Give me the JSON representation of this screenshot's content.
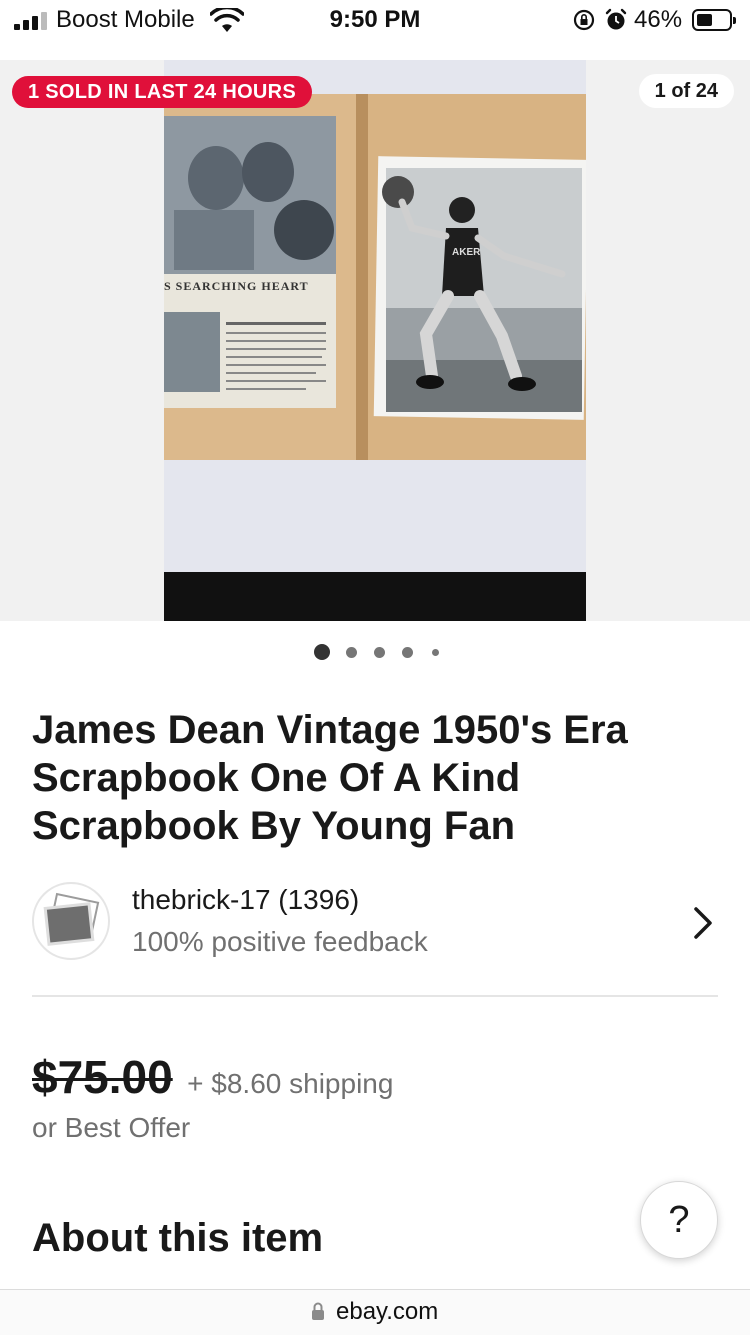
{
  "status_bar": {
    "carrier": "Boost Mobile",
    "time": "9:50 PM",
    "battery": "46%",
    "battery_level": 0.46,
    "icons": [
      "signal-icon",
      "wifi-icon",
      "orientation-lock-icon",
      "alarm-icon",
      "battery-icon"
    ]
  },
  "gallery": {
    "sold_badge": "1 SOLD IN LAST 24 HOURS",
    "counter": "1 of 24",
    "photo_caption": "S SEARCHING HEART",
    "jersey_text": "AKER",
    "dots_active_index": 0,
    "dots_count": 5
  },
  "listing": {
    "title": "James Dean Vintage 1950's Era Scrapbook One Of A Kind Scrapbook By Young Fan"
  },
  "seller": {
    "name": "thebrick-17 (1396)",
    "feedback": "100% positive feedback"
  },
  "price": {
    "amount": "$75.00",
    "shipping": "+ $8.60 shipping",
    "best_offer": "or Best Offer"
  },
  "help": {
    "label": "?"
  },
  "sections": {
    "about": "About this item"
  },
  "browser": {
    "url": "ebay.com"
  },
  "colors": {
    "badge": "#e0103a",
    "text": "#191919",
    "muted": "#707070"
  }
}
